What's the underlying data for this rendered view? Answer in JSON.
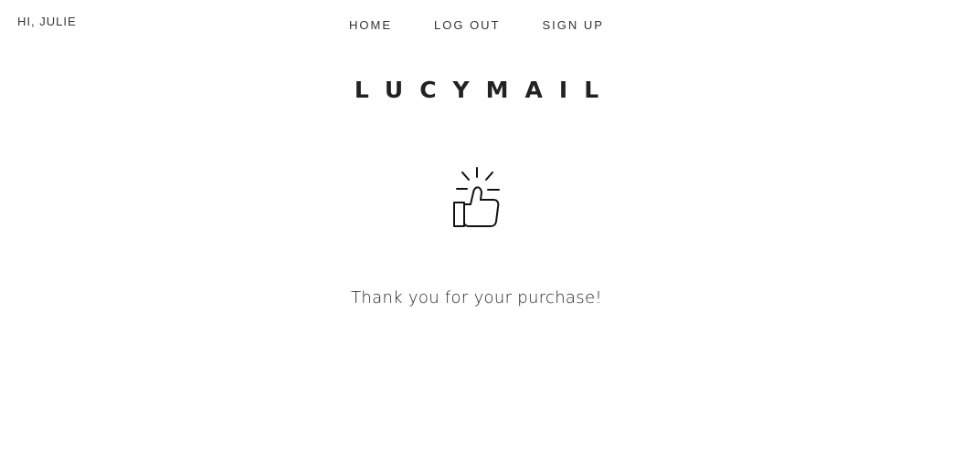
{
  "header": {
    "greeting": "HI, JULIE",
    "nav": {
      "home": "HOME",
      "logout": "LOG OUT",
      "signup": "SIGN UP"
    }
  },
  "brand": {
    "name": "LUCYMAIL"
  },
  "main": {
    "icon": "thumbs-up-icon",
    "message": "Thank you for your purchase!"
  },
  "colors": {
    "text": "#222222",
    "background": "#ffffff"
  }
}
